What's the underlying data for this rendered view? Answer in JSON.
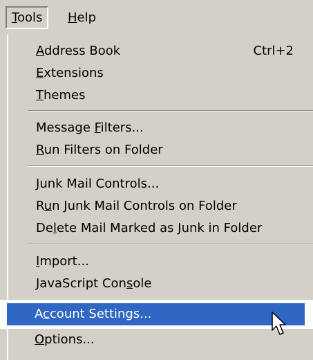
{
  "menubar": {
    "items": [
      {
        "label": "Tools",
        "access_key": "T"
      },
      {
        "label": "Help",
        "access_key": "H"
      }
    ]
  },
  "menu": {
    "groups": [
      [
        {
          "label": "Address Book",
          "access_key": "A",
          "shortcut": "Ctrl+2"
        },
        {
          "label": "Extensions",
          "access_key": "E"
        },
        {
          "label": "Themes",
          "access_key": "T"
        }
      ],
      [
        {
          "label": "Message Filters...",
          "access_key": "F"
        },
        {
          "label": "Run Filters on Folder",
          "access_key": "R"
        }
      ],
      [
        {
          "label": "Junk Mail Controls...",
          "access_key": "J"
        },
        {
          "label": "Run Junk Mail Controls on Folder",
          "access_key": "u"
        },
        {
          "label": "Delete Mail Marked as Junk in Folder",
          "access_key": "l"
        }
      ],
      [
        {
          "label": "Import...",
          "access_key": "I"
        },
        {
          "label": "JavaScript Console",
          "access_key": "s"
        }
      ],
      [
        {
          "label": "Account Settings...",
          "access_key": "c",
          "selected": true
        },
        {
          "label": "Options...",
          "access_key": "O"
        }
      ]
    ]
  },
  "colors": {
    "menu_bg": "#d4d0c8",
    "selection_bg": "#3066c4",
    "selection_text": "#ffffff"
  },
  "icons": {
    "cursor": "arrow-cursor-icon"
  }
}
